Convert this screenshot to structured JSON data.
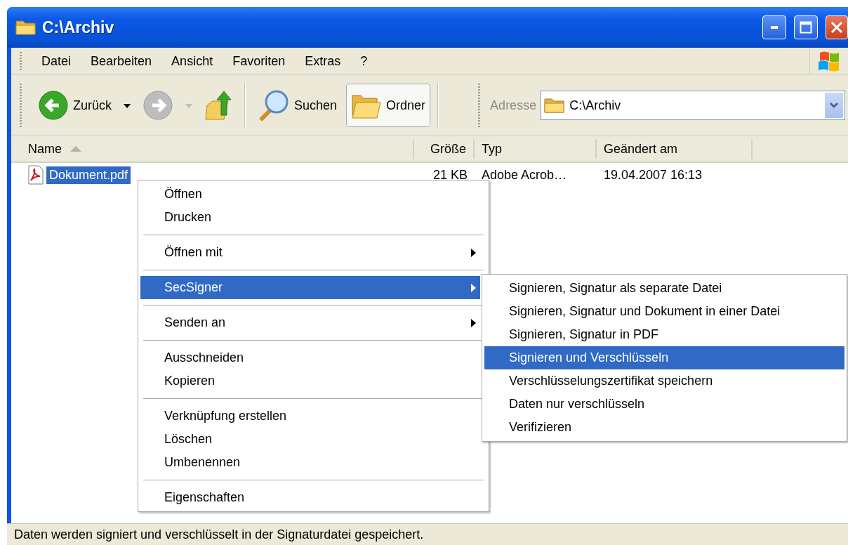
{
  "window": {
    "title": "C:\\Archiv"
  },
  "menu_bar": [
    "Datei",
    "Bearbeiten",
    "Ansicht",
    "Favoriten",
    "Extras",
    "?"
  ],
  "toolbar": {
    "buttons": [
      {
        "kind": "back",
        "label": "Zurück",
        "disabled": false
      },
      {
        "kind": "forward",
        "disabled": true
      },
      {
        "kind": "up"
      },
      {
        "kind": "search",
        "label": "Suchen",
        "selected": false
      },
      {
        "kind": "folders",
        "label": "Ordner",
        "selected": true
      }
    ],
    "address": {
      "label": "Adresse",
      "value": "C:\\Archiv"
    }
  },
  "table": {
    "columns": [
      {
        "label": "Name",
        "sorted": true
      },
      {
        "label": "Größe",
        "sorted": false
      },
      {
        "label": "Typ",
        "sorted": false
      },
      {
        "label": "Geändert am",
        "sorted": false
      }
    ],
    "rows": [
      {
        "cells": [
          "Dokument.pdf",
          "21 KB",
          "Adobe Acrob…",
          "19.04.2007 16:13"
        ],
        "selected": true
      }
    ]
  },
  "context_menu": {
    "items": [
      {
        "kind": "item",
        "label": "Öffnen",
        "submenu": false,
        "selected": false
      },
      {
        "kind": "item",
        "label": "Drucken",
        "submenu": false,
        "selected": false
      },
      {
        "kind": "separator"
      },
      {
        "kind": "item",
        "label": "Öffnen mit",
        "submenu": true,
        "selected": false
      },
      {
        "kind": "separator"
      },
      {
        "kind": "item",
        "label": "SecSigner",
        "submenu": true,
        "selected": true
      },
      {
        "kind": "separator"
      },
      {
        "kind": "item",
        "label": "Senden an",
        "submenu": true,
        "selected": false
      },
      {
        "kind": "separator"
      },
      {
        "kind": "item",
        "label": "Ausschneiden",
        "submenu": false,
        "selected": false
      },
      {
        "kind": "item",
        "label": "Kopieren",
        "submenu": false,
        "selected": false
      },
      {
        "kind": "separator"
      },
      {
        "kind": "item",
        "label": "Verknüpfung erstellen",
        "submenu": false,
        "selected": false
      },
      {
        "kind": "item",
        "label": "Löschen",
        "submenu": false,
        "selected": false
      },
      {
        "kind": "item",
        "label": "Umbenennen",
        "submenu": false,
        "selected": false
      },
      {
        "kind": "separator"
      },
      {
        "kind": "item",
        "label": "Eigenschaften",
        "submenu": false,
        "selected": false
      }
    ]
  },
  "submenu": {
    "items": [
      {
        "label": "Signieren, Signatur als separate Datei",
        "selected": false
      },
      {
        "label": "Signieren, Signatur und Dokument in einer Datei",
        "selected": false
      },
      {
        "label": "Signieren, Signatur in PDF",
        "selected": false
      },
      {
        "label": "Signieren und Verschlüsseln",
        "selected": true
      },
      {
        "label": "Verschlüsselungszertifikat speichern",
        "selected": false
      },
      {
        "label": "Daten nur verschlüsseln",
        "selected": false
      },
      {
        "label": "Verifizieren",
        "selected": false
      }
    ]
  },
  "status_bar": {
    "text": "Daten werden signiert und verschlüsselt in der Signaturdatei gespeichert."
  }
}
